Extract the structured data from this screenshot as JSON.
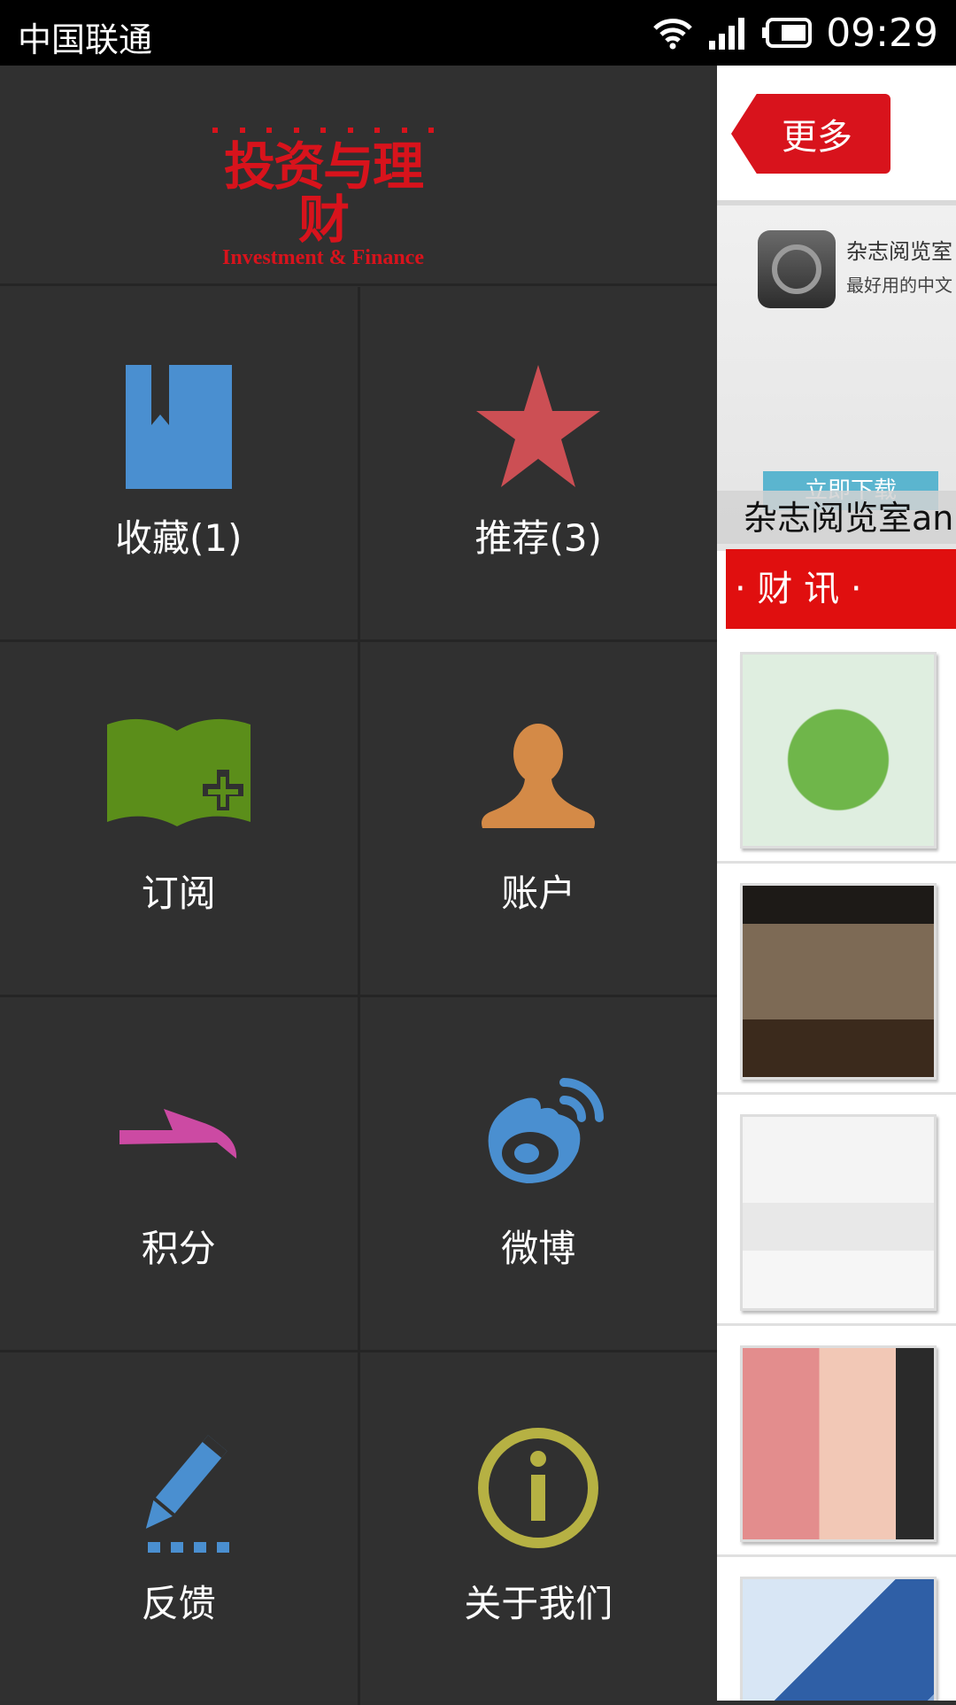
{
  "status_bar": {
    "carrier": "中国联通",
    "time": "09:29"
  },
  "drawer": {
    "logo": {
      "cn": "投资与理财",
      "en": "Investment & Finance",
      "color": "#d8131c"
    },
    "menu": [
      {
        "label": "收藏(1)",
        "icon": "bookmark-icon",
        "color": "#4a8fd0"
      },
      {
        "label": "推荐(3)",
        "icon": "star-icon",
        "color": "#cc4f54"
      },
      {
        "label": "订阅",
        "icon": "book-add-icon",
        "color": "#5b8e1a"
      },
      {
        "label": "账户",
        "icon": "user-icon",
        "color": "#d48a47"
      },
      {
        "label": "积分",
        "icon": "points-icon",
        "color": "#cc4aa3"
      },
      {
        "label": "微博",
        "icon": "weibo-icon",
        "color": "#4a8fd0"
      },
      {
        "label": "反馈",
        "icon": "pencil-icon",
        "color": "#4a8fd0"
      },
      {
        "label": "关于我们",
        "icon": "info-icon",
        "color": "#b6b143"
      }
    ]
  },
  "content": {
    "more_button": "更多",
    "banner": {
      "title": "杂志阅览室",
      "subtitle": "最好用的中文",
      "download": "立即下载",
      "caption": "杂志阅览室an"
    },
    "section_title": "· 财 讯 ·"
  }
}
